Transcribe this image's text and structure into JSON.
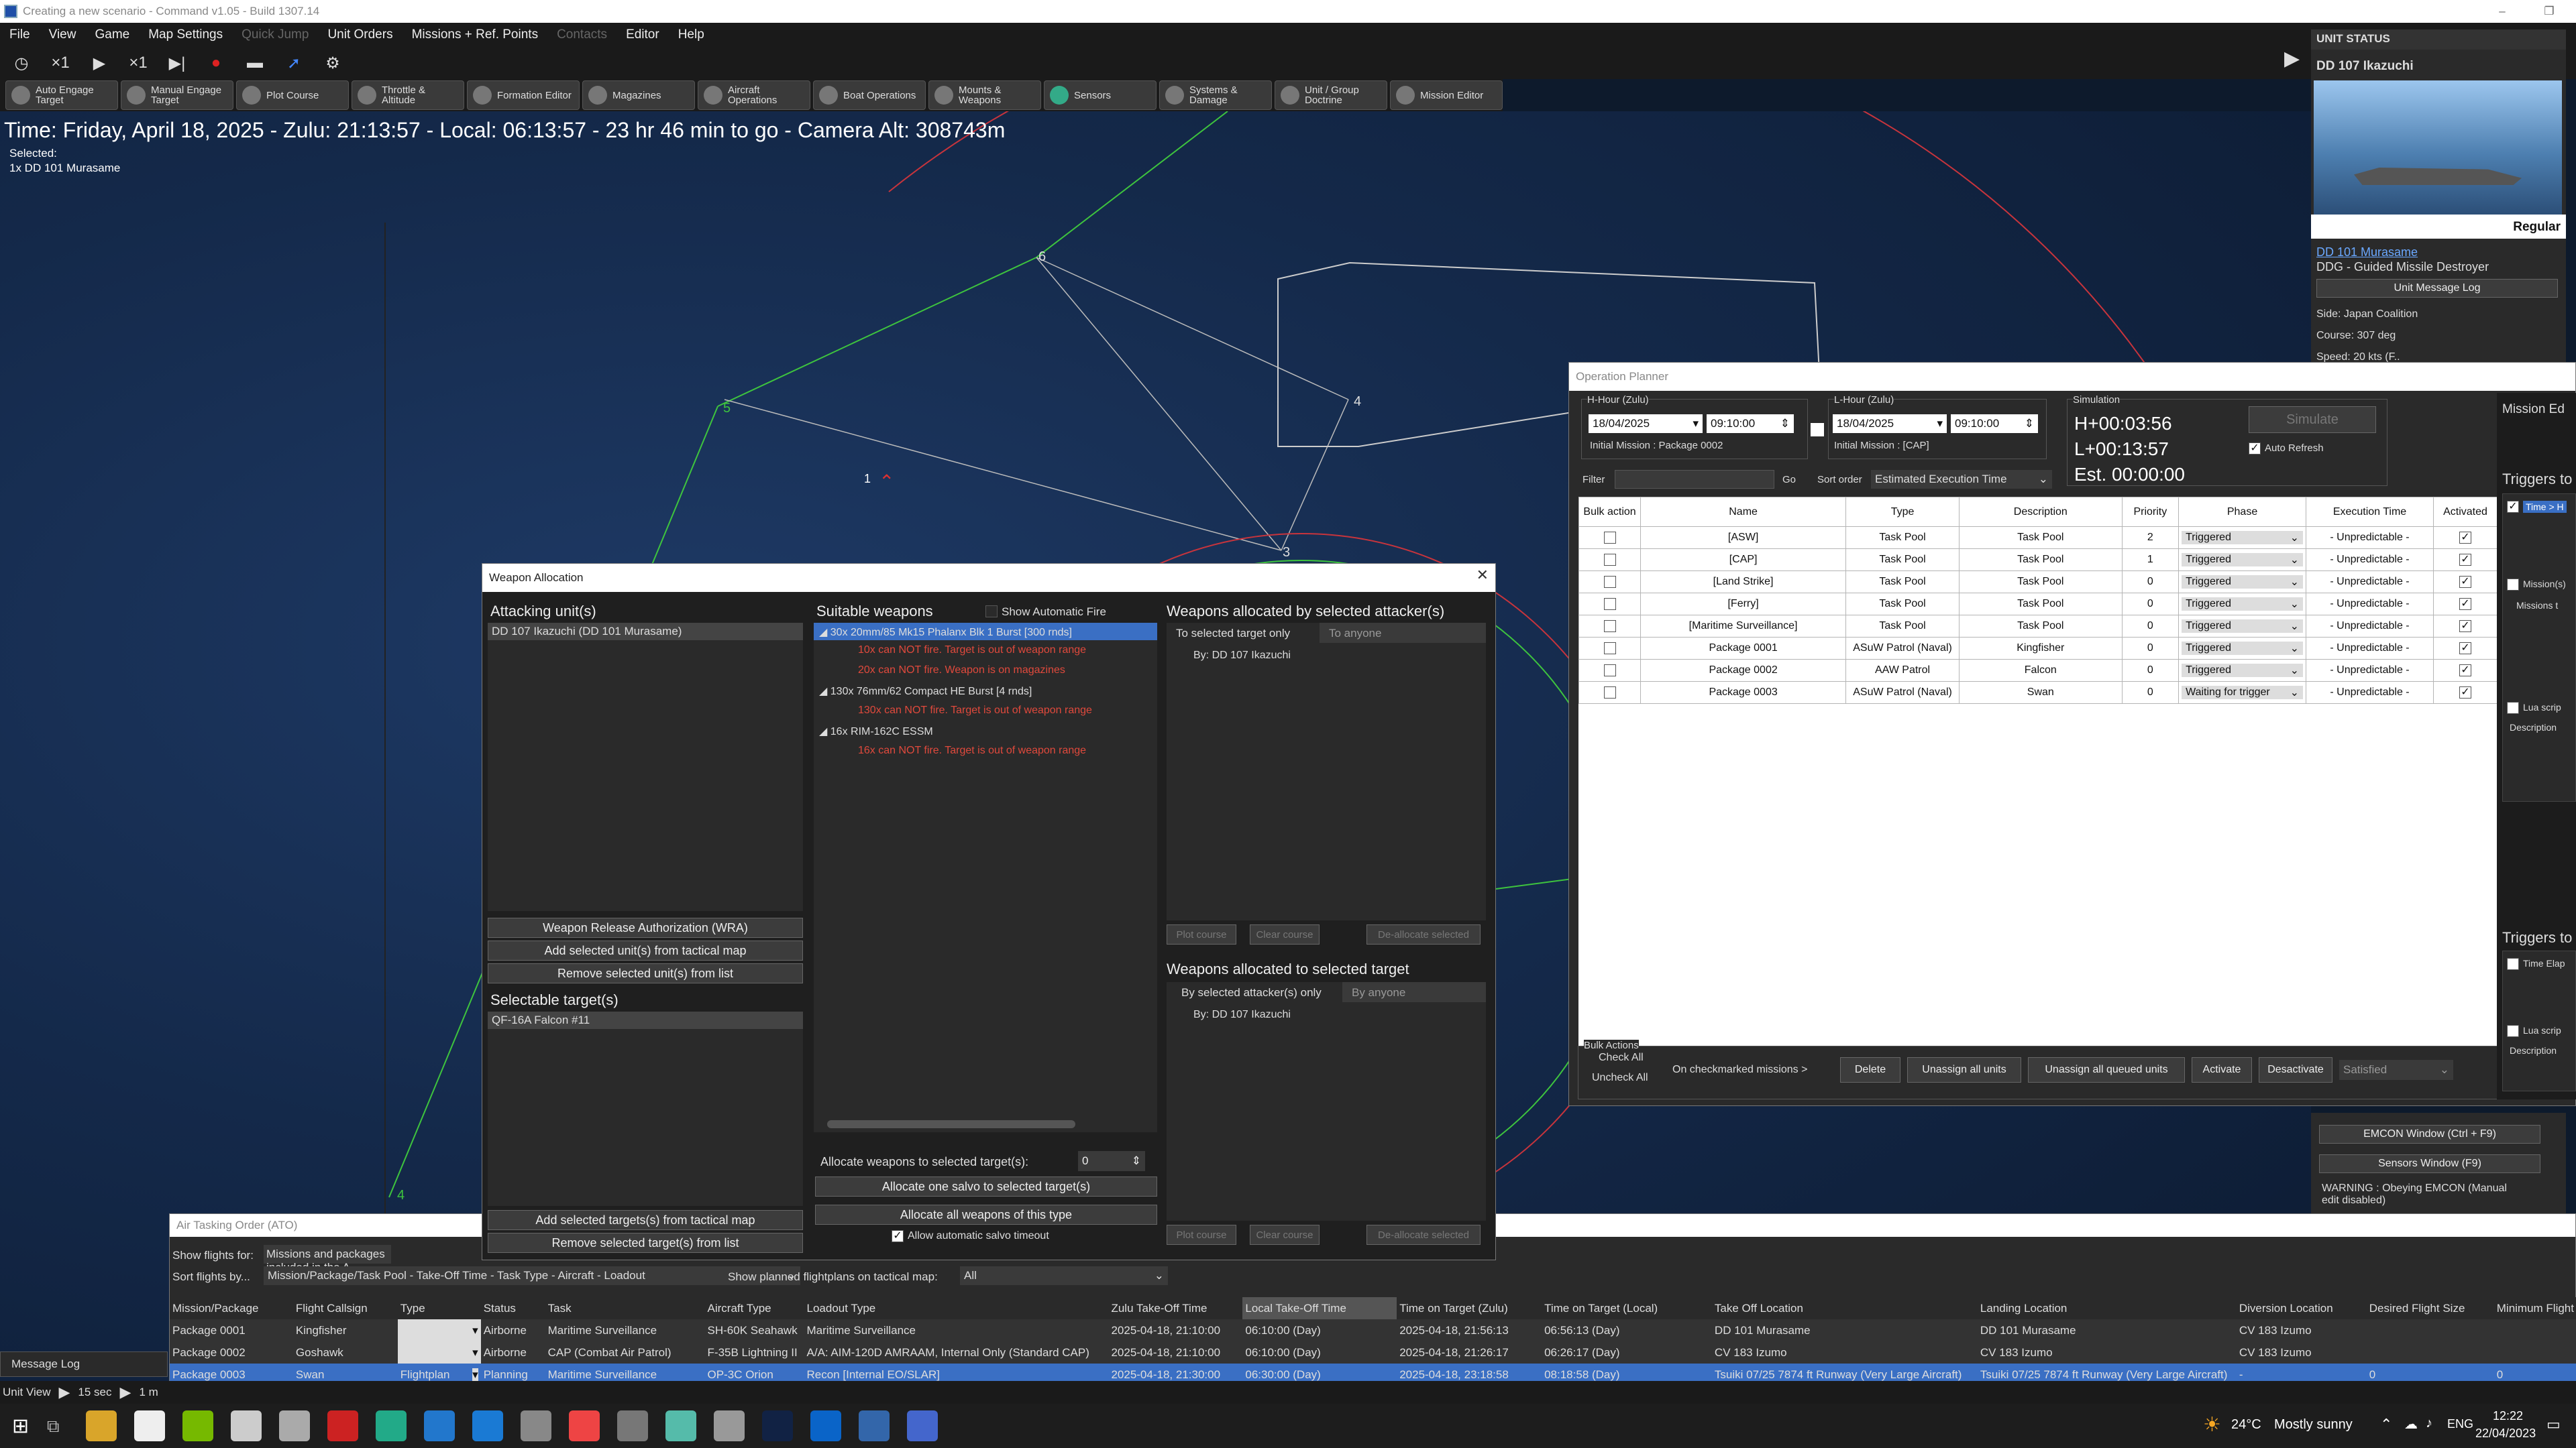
{
  "app": {
    "title": "Creating a new scenario - Command v1.05 - Build 1307.14",
    "window_controls": [
      "–",
      "❐",
      "✕"
    ]
  },
  "menu": [
    "File",
    "View",
    "Game",
    "Map Settings",
    "Quick Jump",
    "Unit Orders",
    "Missions + Ref. Points",
    "Contacts",
    "Editor",
    "Help"
  ],
  "menu_disabled": [
    "Quick Jump",
    "Contacts"
  ],
  "toolbar1": {
    "clock": "×1",
    "speed": "×1"
  },
  "toolbar2": [
    "Auto Engage Target",
    "Manual Engage Target",
    "Plot Course",
    "Throttle & Altitude",
    "Formation Editor",
    "Magazines",
    "Aircraft Operations",
    "Boat Operations",
    "Mounts & Weapons",
    "Sensors",
    "Systems & Damage",
    "Unit / Group Doctrine",
    "Mission Editor"
  ],
  "map": {
    "time_line": "Time: Friday, April 18, 2025 - Zulu: 21:13:57 - Local: 06:13:57 - 23 hr 46 min to go -  Camera Alt: 308743m",
    "selected_label": "Selected:",
    "selected_value": "1x DD 101 Murasame",
    "ref_points": [
      "6",
      "5",
      "4",
      "3",
      "4",
      "1"
    ]
  },
  "unit_status": {
    "header": "UNIT STATUS",
    "unit_name": "DD 107 Ikazuchi",
    "proficiency": "Regular",
    "link": "DD 101 Murasame",
    "class": "DDG - Guided Missile Destroyer",
    "msg_log_button": "Unit Message Log",
    "side": "Side: Japan Coalition",
    "course": "Course: 307 deg",
    "speed": "Speed: 20 kts (F..",
    "emcon_button": "EMCON Window (Ctrl + F9)",
    "sensors_button": "Sensors Window (F9)",
    "warning": "WARNING : Obeying EMCON (Manual edit disabled)"
  },
  "weapon_allocation": {
    "title": "Weapon Allocation",
    "attacking_header": "Attacking unit(s)",
    "attacking_units": [
      "DD 107 Ikazuchi  (DD 101 Murasame)"
    ],
    "wra_button": "Weapon Release Authorization (WRA)",
    "add_units_button": "Add selected unit(s) from tactical map",
    "remove_units_button": "Remove selected unit(s) from list",
    "targets_header": "Selectable target(s)",
    "targets": [
      "QF-16A Falcon #11"
    ],
    "add_targets_button": "Add selected targets(s) from tactical map",
    "remove_targets_button": "Remove selected target(s) from list",
    "suitable_header": "Suitable weapons",
    "show_auto_fire": "Show Automatic Fire",
    "weapons": [
      {
        "name": "30x 20mm/85 Mk15 Phalanx Blk 1 Burst [300 rnds]",
        "notes": [
          "10x can NOT fire. Target is out of weapon range",
          "20x can NOT fire. Weapon is on magazines"
        ]
      },
      {
        "name": "130x 76mm/62 Compact HE Burst [4 rnds]",
        "notes": [
          "130x can NOT fire. Target is out of weapon range"
        ]
      },
      {
        "name": "16x RIM-162C ESSM",
        "notes": [
          "16x can NOT fire. Target is out of weapon range"
        ]
      }
    ],
    "allocate_label": "Allocate weapons to selected target(s):",
    "allocate_value": "0",
    "allocate_salvo": "Allocate one salvo to selected target(s)",
    "allocate_all": "Allocate all weapons of this type",
    "allow_timeout": "Allow automatic salvo timeout",
    "by_attacker_header": "Weapons allocated by selected attacker(s)",
    "tab_target_only": "To selected target only",
    "tab_anyone": "To anyone",
    "by_label1": "By: DD 107 Ikazuchi",
    "plot_course": "Plot course",
    "clear_course": "Clear course",
    "deallocate": "De-allocate selected",
    "to_target_header": "Weapons allocated to selected target",
    "tab_attacker_only": "By selected attacker(s) only",
    "tab_by_anyone": "By anyone",
    "by_label2": "By: DD 107 Ikazuchi"
  },
  "op_planner": {
    "title": "Operation Planner",
    "hhour_label": "H-Hour (Zulu)",
    "hhour_date": "18/04/2025",
    "hhour_time": "09:10:00",
    "hhour_mission": "Initial Mission : Package 0002",
    "lhour_label": "L-Hour (Zulu)",
    "lhour_date": "18/04/2025",
    "lhour_time": "09:10:00",
    "lhour_mission": "Initial Mission : [CAP]",
    "sim_label": "Simulation",
    "simulate": "Simulate",
    "auto_refresh": "Auto Refresh",
    "h_plus": "H+00:03:56",
    "l_plus": "L+00:13:57",
    "est": "Est. 00:00:00",
    "filter": "Filter",
    "go": "Go",
    "sort_order": "Sort order",
    "sort_value": "Estimated Execution Time",
    "columns": [
      "Bulk action",
      "Name",
      "Type",
      "Description",
      "Priority",
      "Phase",
      "Execution Time",
      "Activated"
    ],
    "rows": [
      {
        "name": "[ASW]",
        "type": "Task Pool",
        "desc": "Task Pool",
        "prio": "2",
        "phase": "Triggered",
        "exec": "- Unpredictable -"
      },
      {
        "name": "[CAP]",
        "type": "Task Pool",
        "desc": "Task Pool",
        "prio": "1",
        "phase": "Triggered",
        "exec": "- Unpredictable -"
      },
      {
        "name": "[Land Strike]",
        "type": "Task Pool",
        "desc": "Task Pool",
        "prio": "0",
        "phase": "Triggered",
        "exec": "- Unpredictable -"
      },
      {
        "name": "[Ferry]",
        "type": "Task Pool",
        "desc": "Task Pool",
        "prio": "0",
        "phase": "Triggered",
        "exec": "- Unpredictable -"
      },
      {
        "name": "[Maritime Surveillance]",
        "type": "Task Pool",
        "desc": "Task Pool",
        "prio": "0",
        "phase": "Triggered",
        "exec": "- Unpredictable -"
      },
      {
        "name": "Package 0001",
        "type": "ASuW Patrol (Naval)",
        "desc": "Kingfisher",
        "prio": "0",
        "phase": "Triggered",
        "exec": "- Unpredictable -"
      },
      {
        "name": "Package 0002",
        "type": "AAW Patrol",
        "desc": "Falcon",
        "prio": "0",
        "phase": "Triggered",
        "exec": "- Unpredictable -"
      },
      {
        "name": "Package 0003",
        "type": "ASuW Patrol (Naval)",
        "desc": "Swan",
        "prio": "0",
        "phase": "Waiting for trigger",
        "exec": "- Unpredictable -"
      }
    ],
    "bulk_actions": "Bulk Actions",
    "check_all": "Check All",
    "uncheck_all": "Uncheck All",
    "on_checkmarked": "On checkmarked missions >",
    "delete": "Delete",
    "unassign_all": "Unassign all units",
    "unassign_queued": "Unassign all queued units",
    "activate": "Activate",
    "deactivate": "Desactivate",
    "satisfied": "Satisfied",
    "side_title": "Mission Ed",
    "triggers1": "Triggers to",
    "time_gt": "Time > H",
    "missions": "Mission(s)",
    "missions_to": "Missions t",
    "lua1": "Lua scrip",
    "description1": "Description",
    "triggers2": "Triggers to",
    "time_elapsed": "Time Elap",
    "lua2": "Lua scrip",
    "description2": "Description"
  },
  "ato": {
    "title": "Air Tasking Order (ATO)",
    "show_flights_label": "Show flights for:",
    "show_flights_value": "Missions and packages included in the A",
    "sort_label": "Sort flights by...",
    "sort_value": "Mission/Package/Task Pool - Take-Off Time - Task Type - Aircraft - Loadout",
    "show_planned": "Show planned flightplans on tactical map:",
    "show_planned_value": "All",
    "columns": [
      "Mission/Package",
      "Flight Callsign",
      "Type",
      "Status",
      "Task",
      "Aircraft Type",
      "Loadout Type",
      "Zulu Take-Off Time",
      "Local Take-Off Time",
      "Time on Target (Zulu)",
      "Time on Target (Local)",
      "Take Off Location",
      "Landing Location",
      "Diversion Location",
      "Desired Flight Size",
      "Minimum Flight"
    ],
    "rows": [
      {
        "pkg": "Package 0001",
        "call": "Kingfisher",
        "type": "",
        "status": "Airborne",
        "task": "Maritime Surveillance",
        "ac": "SH-60K Seahawk",
        "load": "Maritime Surveillance",
        "ztake": "2025-04-18, 21:10:00",
        "ltake": "06:10:00 (Day)",
        "ztot": "2025-04-18, 21:56:13",
        "ltot": "06:56:13 (Day)",
        "tol": "DD 101 Murasame",
        "land": "DD 101 Murasame",
        "div": "CV 183 Izumo",
        "size": "",
        "min": ""
      },
      {
        "pkg": "Package 0002",
        "call": "Goshawk",
        "type": "",
        "status": "Airborne",
        "task": "CAP (Combat Air Patrol)",
        "ac": "F-35B Lightning II",
        "load": "A/A: AIM-120D AMRAAM, Internal Only (Standard CAP)",
        "ztake": "2025-04-18, 21:10:00",
        "ltake": "06:10:00 (Day)",
        "ztot": "2025-04-18, 21:26:17",
        "ltot": "06:26:17 (Day)",
        "tol": "CV 183 Izumo",
        "land": "CV 183 Izumo",
        "div": "CV 183 Izumo",
        "size": "",
        "min": ""
      },
      {
        "pkg": "Package 0003",
        "call": "Swan",
        "type": "Flightplan",
        "status": "Planning",
        "task": "Maritime Surveillance",
        "ac": "OP-3C Orion",
        "load": "Recon [Internal EO/SLAR]",
        "ztake": "2025-04-18, 21:30:00",
        "ltake": "06:30:00 (Day)",
        "ztot": "2025-04-18, 23:18:58",
        "ltot": "08:18:58 (Day)",
        "tol": "Tsuiki 07/25 7874 ft Runway (Very Large Aircraft)",
        "land": "Tsuiki 07/25 7874 ft Runway (Very Large Aircraft)",
        "div": "-",
        "size": "0",
        "min": "0"
      }
    ]
  },
  "message_log": "Message Log",
  "bottombar": {
    "unit_view": "Unit View",
    "interval": "15 sec",
    "extra": "1 m"
  },
  "taskbar": {
    "weather_temp": "24°C",
    "weather_desc": "Mostly sunny",
    "language": "ENG",
    "time": "12:22",
    "date": "22/04/2023"
  },
  "colors": {
    "accent_blue": "#3a6fc4",
    "warning_red": "#e0493c",
    "map_green": "#3ec43e",
    "map_red": "#c8343c"
  }
}
